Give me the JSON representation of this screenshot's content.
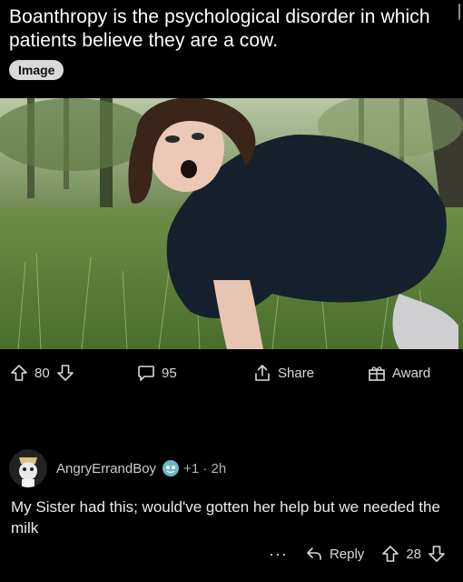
{
  "post": {
    "title": "Boanthropy is the psychological disorder in which patients believe they are a cow.",
    "flair": "Image"
  },
  "actions": {
    "upvotes": "80",
    "comments": "95",
    "share_label": "Share",
    "award_label": "Award"
  },
  "comment": {
    "username": "AngryErrandBoy",
    "meta": "+1 · 2h",
    "body": "My Sister had this; would've gotten her help but we needed the milk",
    "more": "···",
    "reply_label": "Reply",
    "score": "28"
  },
  "icons": {
    "upvote": "arrow-up-icon",
    "downvote": "arrow-down-icon",
    "comment": "chat-bubble-icon",
    "share": "share-icon",
    "award": "gift-icon",
    "reply": "reply-arrow-icon"
  },
  "colors": {
    "background": "#000000",
    "title": "#ffffff",
    "flair_bg": "#d9d9d9",
    "text": "#d7dadc"
  }
}
